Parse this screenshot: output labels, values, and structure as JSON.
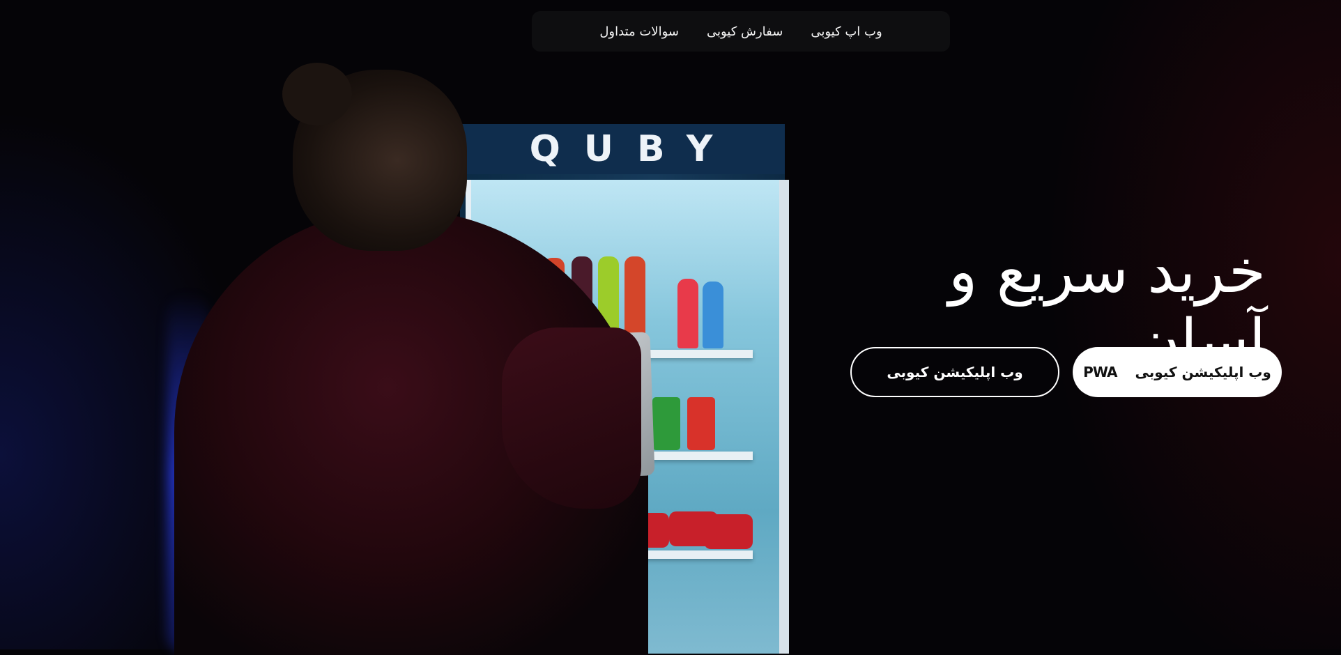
{
  "nav": {
    "items": [
      {
        "label": "وب اپ کیوبی"
      },
      {
        "label": "سفارش کیوبی"
      },
      {
        "label": "سوالات متداول"
      }
    ]
  },
  "hero": {
    "title": "خرید سریع و آسان",
    "brand_sign": "QUBY",
    "buttons": [
      {
        "label": "وب اپلیکیشن کیوبی",
        "badge": "PWA"
      },
      {
        "label": "وب اپلیکیشن کیوبی"
      }
    ]
  },
  "colors": {
    "background": "#050407",
    "nav_background": "#0e0e10",
    "primary_button": "#ffffff",
    "text": "#ffffff"
  }
}
